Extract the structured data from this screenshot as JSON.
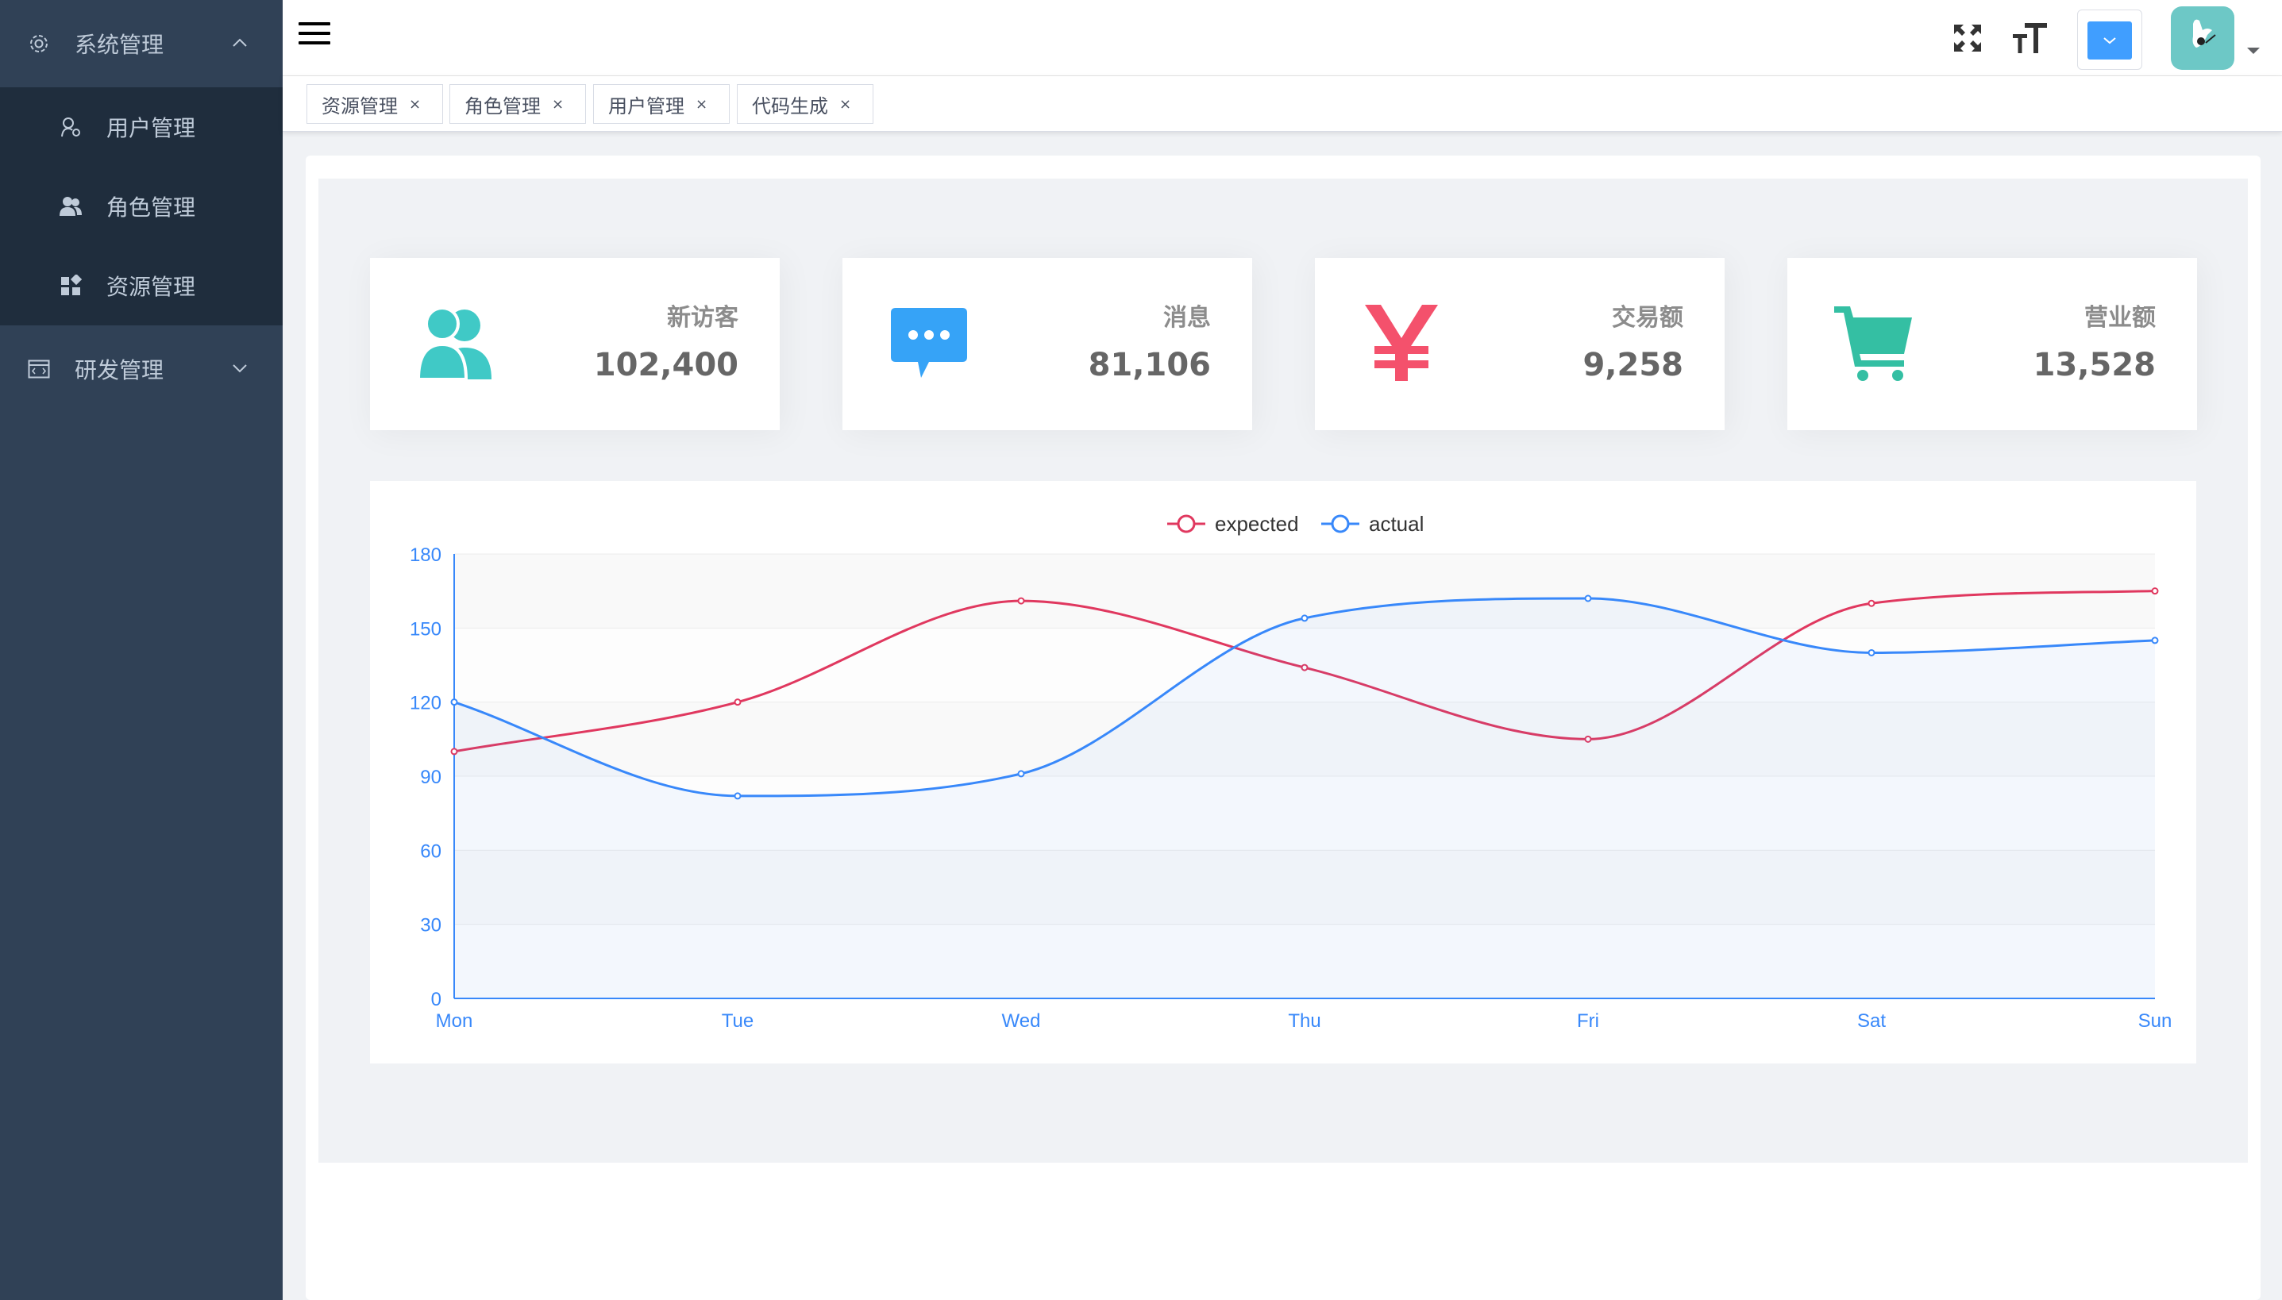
{
  "sidebar": {
    "menus": [
      {
        "label": "系统管理",
        "icon": "gear-icon",
        "expanded": true,
        "children": [
          {
            "label": "用户管理",
            "icon": "user-icon"
          },
          {
            "label": "角色管理",
            "icon": "users-icon"
          },
          {
            "label": "资源管理",
            "icon": "grid-icon"
          }
        ]
      },
      {
        "label": "研发管理",
        "icon": "code-window-icon",
        "expanded": false
      }
    ],
    "colors": {
      "bg": "#304156",
      "submenu_bg": "#1f2d3d",
      "text": "#bfcbd9"
    }
  },
  "navbar": {
    "icons": [
      "hamburger-icon",
      "fullscreen-icon",
      "text-size-icon",
      "chevron-down-icon",
      "avatar",
      "caret-down-icon"
    ]
  },
  "tags": [
    "资源管理",
    "角色管理",
    "用户管理",
    "代码生成"
  ],
  "cards": [
    {
      "title": "新访客",
      "value": "102,400",
      "icon": "people-icon",
      "color": "#40c9c6"
    },
    {
      "title": "消息",
      "value": "81,106",
      "icon": "message-icon",
      "color": "#36a3f7"
    },
    {
      "title": "交易额",
      "value": "9,258",
      "icon": "yen-icon",
      "color": "#f4516c"
    },
    {
      "title": "营业额",
      "value": "13,528",
      "icon": "shopping-cart-icon",
      "color": "#34bfa3"
    }
  ],
  "chart_data": {
    "type": "line",
    "categories": [
      "Mon",
      "Tue",
      "Wed",
      "Thu",
      "Fri",
      "Sat",
      "Sun"
    ],
    "series": [
      {
        "name": "expected",
        "values": [
          100,
          120,
          161,
          134,
          105,
          160,
          165
        ],
        "color": "#e0385f"
      },
      {
        "name": "actual",
        "values": [
          120,
          82,
          91,
          154,
          162,
          140,
          145
        ],
        "color": "#3888fa"
      }
    ],
    "ylim": [
      0,
      180
    ],
    "yticks": [
      0,
      30,
      60,
      90,
      120,
      150,
      180
    ],
    "legend": "top-center",
    "grid": true,
    "smooth": true
  }
}
